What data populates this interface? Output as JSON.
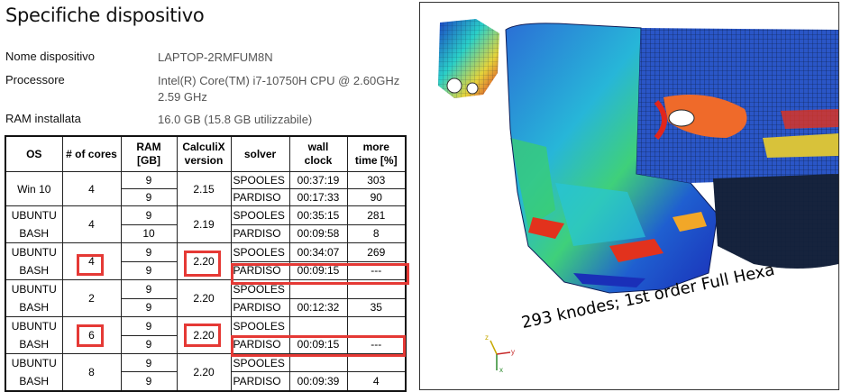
{
  "specs": {
    "title": "Specifiche dispositivo",
    "rows": [
      {
        "label": "Nome dispositivo",
        "value": "LAPTOP-2RMFUM8N"
      },
      {
        "label": "Processore",
        "value": "Intel(R) Core(TM) i7-10750H CPU @ 2.60GHz",
        "value2": "2.59 GHz"
      },
      {
        "label": "RAM installata",
        "value": "16.0 GB (15.8 GB utilizzabile)"
      }
    ]
  },
  "table": {
    "headers": {
      "os": "OS",
      "cores": "# of cores",
      "ram1": "RAM",
      "ram2": "[GB]",
      "ccx1": "CalculiX",
      "ccx2": "version",
      "solver": "solver",
      "wall1": "wall",
      "wall2": "clock",
      "more1": "more",
      "more2": "time [%]"
    },
    "groups": [
      {
        "os": "Win 10",
        "os2": "",
        "cores": "4",
        "version": "2.15",
        "rows": [
          {
            "ram": "9",
            "solver": "SPOOLES",
            "wall": "00:37:19",
            "more": "303"
          },
          {
            "ram": "9",
            "solver": "PARDISO",
            "wall": "00:17:33",
            "more": "90"
          }
        ]
      },
      {
        "os": "UBUNTU",
        "os2": "BASH",
        "cores": "4",
        "version": "2.19",
        "rows": [
          {
            "ram": "9",
            "solver": "SPOOLES",
            "wall": "00:35:15",
            "more": "281"
          },
          {
            "ram": "10",
            "solver": "PARDISO",
            "wall": "00:09:58",
            "more": "8"
          }
        ]
      },
      {
        "os": "UBUNTU",
        "os2": "BASH",
        "cores": "4",
        "version": "2.20",
        "rows": [
          {
            "ram": "9",
            "solver": "SPOOLES",
            "wall": "00:34:07",
            "more": "269"
          },
          {
            "ram": "9",
            "solver": "PARDISO",
            "wall": "00:09:15",
            "more": "---"
          }
        ]
      },
      {
        "os": "UBUNTU",
        "os2": "BASH",
        "cores": "2",
        "version": "2.20",
        "rows": [
          {
            "ram": "9",
            "solver": "SPOOLES",
            "wall": "",
            "more": ""
          },
          {
            "ram": "9",
            "solver": "PARDISO",
            "wall": "00:12:32",
            "more": "35"
          }
        ]
      },
      {
        "os": "UBUNTU",
        "os2": "BASH",
        "cores": "6",
        "version": "2.20",
        "rows": [
          {
            "ram": "9",
            "solver": "SPOOLES",
            "wall": "",
            "more": ""
          },
          {
            "ram": "9",
            "solver": "PARDISO",
            "wall": "00:09:15",
            "more": "---"
          }
        ]
      },
      {
        "os": "UBUNTU",
        "os2": "BASH",
        "cores": "8",
        "version": "2.20",
        "rows": [
          {
            "ram": "9",
            "solver": "SPOOLES",
            "wall": "",
            "more": ""
          },
          {
            "ram": "9",
            "solver": "PARDISO",
            "wall": "00:09:39",
            "more": "4"
          }
        ]
      }
    ]
  },
  "render": {
    "caption": "293 knodes; 1st order Full Hexa",
    "axes": {
      "x": "x",
      "y": "y",
      "z": "z"
    }
  },
  "colors": {
    "highlight": "#e53935",
    "contour_low": "#1e3fbf",
    "contour_mid": "#28c7d8",
    "contour_high": "#e32318"
  }
}
